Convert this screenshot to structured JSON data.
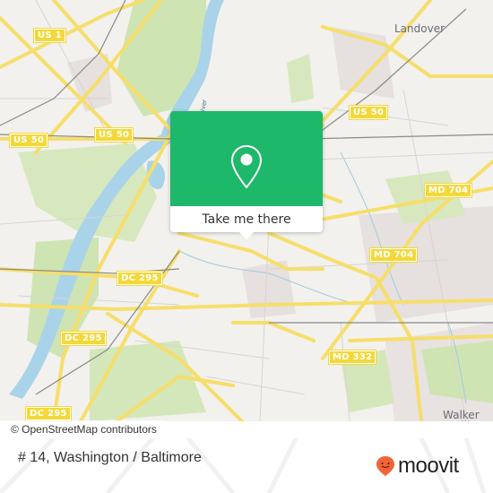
{
  "map": {
    "place_labels": [
      {
        "id": "landover",
        "text": "Landover"
      },
      {
        "id": "walker-mill",
        "text": "Walker Mill"
      }
    ],
    "river_label": "Anacostia River",
    "river_label_visible": "River",
    "road_shields": [
      {
        "id": "us1",
        "text": "US 1"
      },
      {
        "id": "us50-west",
        "text": "US 50"
      },
      {
        "id": "us50-center",
        "text": "US 50"
      },
      {
        "id": "us50-east",
        "text": "US 50"
      },
      {
        "id": "md704-north",
        "text": "MD 704"
      },
      {
        "id": "md704-south",
        "text": "MD 704"
      },
      {
        "id": "dc295-north",
        "text": "DC 295"
      },
      {
        "id": "dc295-middle",
        "text": "DC 295"
      },
      {
        "id": "dc295-south",
        "text": "DC 295"
      },
      {
        "id": "md332",
        "text": "MD 332"
      }
    ],
    "attribution": "© OpenStreetMap contributors",
    "colors": {
      "land": "#f2f1ee",
      "park": "#cfe4b3",
      "water": "#a9d3e8",
      "road_major": "#f6de6a",
      "urban": "#e6e0df"
    }
  },
  "popup": {
    "button_label": "Take me there",
    "icon": "map-pin-icon",
    "color": "#1db86a"
  },
  "footer": {
    "title": "# 14, Washington / Baltimore",
    "brand": "moovit",
    "brand_color": "#f26335"
  }
}
